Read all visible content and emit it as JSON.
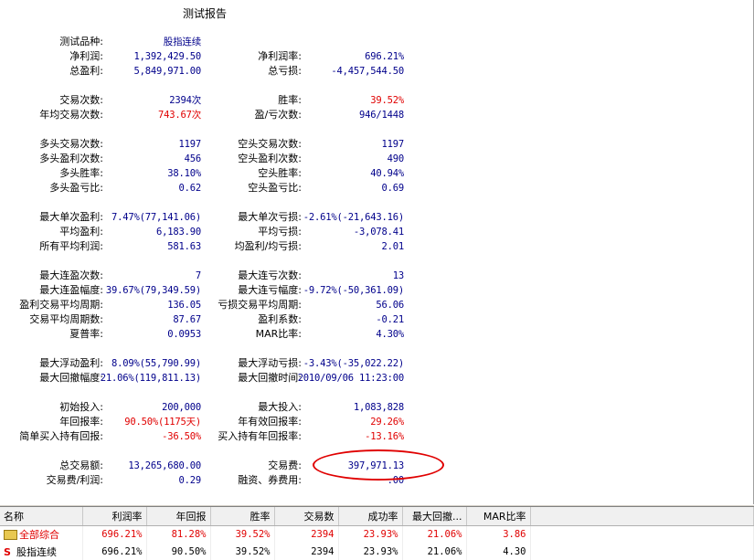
{
  "report": {
    "title": "测试报告",
    "sections": [
      {
        "rows": [
          {
            "l1": "测试品种:",
            "v1": "股指连续",
            "l2": "净利润率:",
            "v2": "696.21%"
          },
          {
            "l1": "净利润:",
            "v1": "1,392,429.50",
            "l2": "净利润率:",
            "v2": "696.21%"
          },
          {
            "l1": "总盈利:",
            "v1": "5,849,971.00",
            "l2": "总亏损:",
            "v2": "-4,457,544.50"
          }
        ]
      },
      {
        "rows": [
          {
            "l1": "交易次数:",
            "v1": "2394次",
            "l2": "胜率:",
            "v2": "39.52%"
          },
          {
            "l1": "年均交易次数:",
            "v1": "743.67次",
            "l2": "盈/亏次数:",
            "v2": "946/1448"
          }
        ]
      },
      {
        "rows": [
          {
            "l1": "多头交易次数:",
            "v1": "1197",
            "l2": "空头交易次数:",
            "v2": "1197"
          },
          {
            "l1": "多头盈利次数:",
            "v1": "456",
            "l2": "空头盈利次数:",
            "v2": "490"
          },
          {
            "l1": "多头胜率:",
            "v1": "38.10%",
            "l2": "空头胜率:",
            "v2": "40.94%"
          },
          {
            "l1": "多头盈亏比:",
            "v1": "0.62",
            "l2": "空头盈亏比:",
            "v2": "0.69"
          }
        ]
      },
      {
        "rows": [
          {
            "l1": "最大单次盈利:",
            "v1": "7.47%(77,141.06)",
            "l2": "最大单次亏损:",
            "v2": "-2.61%(-21,643.16)"
          },
          {
            "l1": "平均盈利:",
            "v1": "6,183.90",
            "l2": "平均亏损:",
            "v2": "-3,078.41"
          },
          {
            "l1": "所有平均利润:",
            "v1": "581.63",
            "l2": "均盈利/均亏损:",
            "v2": "2.01"
          }
        ]
      },
      {
        "rows": [
          {
            "l1": "最大连盈次数:",
            "v1": "7",
            "l2": "最大连亏次数:",
            "v2": "13"
          },
          {
            "l1": "最大连盈幅度:",
            "v1": "39.67%(79,349.59)",
            "l2": "最大连亏幅度:",
            "v2": "-9.72%(-50,361.09)"
          },
          {
            "l1": "盈利交易平均周期:",
            "v1": "136.05",
            "l2": "亏损交易平均周期:",
            "v2": "56.06"
          },
          {
            "l1": "交易平均周期数:",
            "v1": "87.67",
            "l2": "盈利系数:",
            "v2": "-0.21"
          },
          {
            "l1": "夏普率:",
            "v1": "0.0953",
            "l2": "MAR比率:",
            "v2": "4.30%"
          }
        ]
      },
      {
        "rows": [
          {
            "l1": "最大浮动盈利:",
            "v1": "8.09%(55,790.99)",
            "l2": "最大浮动亏损:",
            "v2": "-3.43%(-35,022.22)"
          },
          {
            "l1": "最大回撤幅度:",
            "v1": "21.06%(119,811.13)",
            "l2": "最大回撤时间:",
            "v2": "2010/09/06 11:23:00"
          }
        ]
      },
      {
        "rows": [
          {
            "l1": "初始投入:",
            "v1": "200,000",
            "l2": "最大投入:",
            "v2": "1,083,828"
          },
          {
            "l1": "年回报率:",
            "v1": "90.50%(1175天)",
            "l2": "年有效回报率:",
            "v2": "29.26%"
          },
          {
            "l1": "简单买入持有回报:",
            "v1": "-36.50%",
            "l2": "买入持有年回报率:",
            "v2": "-13.16%"
          }
        ]
      },
      {
        "rows": [
          {
            "l1": "总交易额:",
            "v1": "13,265,680.00",
            "l2": "交易费:",
            "v2": "397,971.13"
          },
          {
            "l1": "交易费/利润:",
            "v1": "0.29",
            "l2": "融资、券费用:",
            "v2": ".00"
          }
        ]
      }
    ]
  },
  "table": {
    "headers": [
      "名称",
      "利润率",
      "年回报",
      "胜率",
      "交易数",
      "成功率",
      "最大回撤...",
      "MAR比率"
    ],
    "rows": [
      {
        "name": "全部综合",
        "icon": "folder-icon",
        "values": [
          "696.21%",
          "81.28%",
          "39.52%",
          "2394",
          "23.93%",
          "21.06%",
          "3.86"
        ]
      },
      {
        "name": "股指连续",
        "icon": "s-icon",
        "values": [
          "696.21%",
          "90.50%",
          "39.52%",
          "2394",
          "23.93%",
          "21.06%",
          "4.30"
        ]
      }
    ]
  },
  "colors": {
    "value_blue": "#00008b",
    "value_red": "#e00000",
    "highlight": "#e00000"
  }
}
